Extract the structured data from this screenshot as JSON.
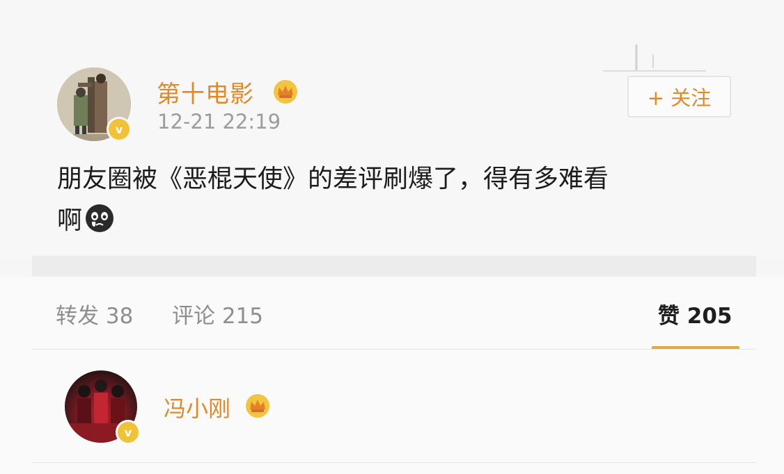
{
  "post": {
    "author": "第十电影",
    "timestamp": "12-21 22:19",
    "follow_label": "+ 关注",
    "text_line1": "朋友圈被《恶棍天使》的差评刷爆了，得有多难看",
    "text_line2": "啊",
    "emoji": "crying-face-emoji"
  },
  "actions": {
    "repost": "转发 38",
    "comment": "评论 215",
    "like": "赞 205"
  },
  "likers": [
    {
      "name": "冯小刚"
    }
  ],
  "colors": {
    "accent": "#e0892a",
    "verified_badge": "#f0c23a",
    "active_tab_underline": "#e8a73c"
  }
}
